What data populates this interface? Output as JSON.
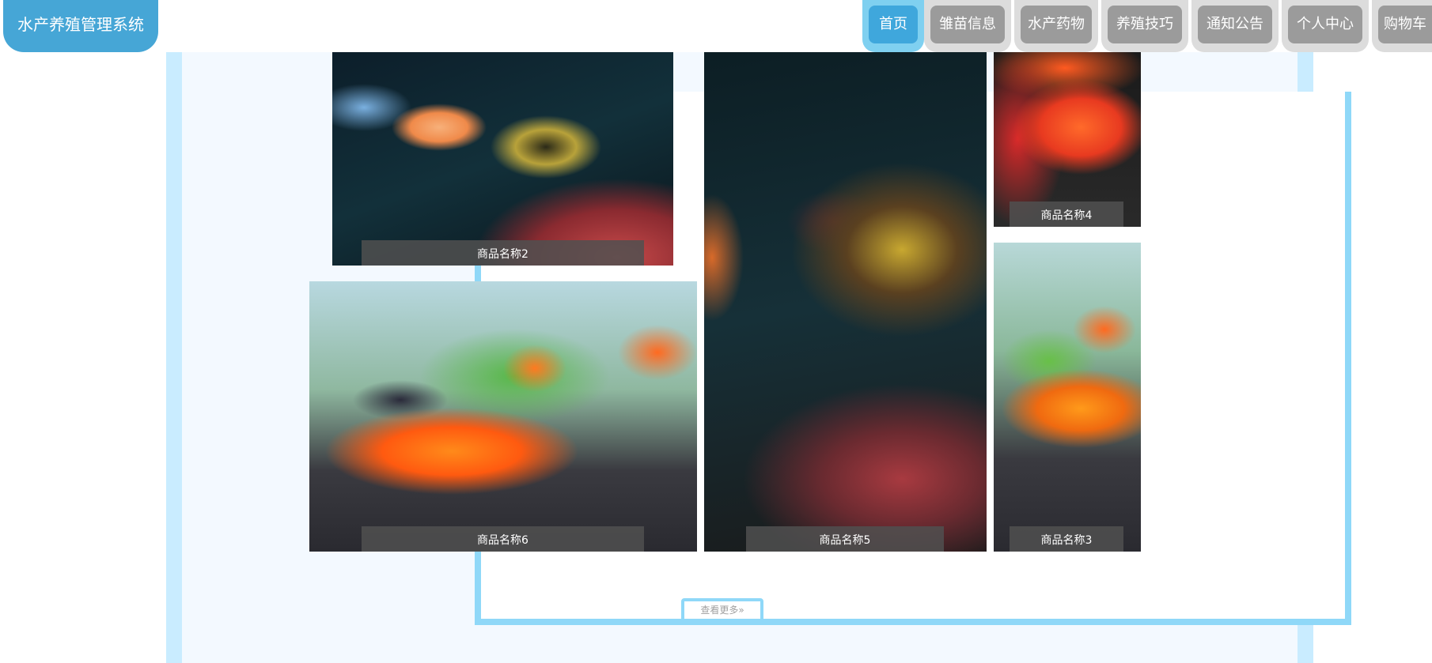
{
  "app": {
    "title": "水产养殖管理系统"
  },
  "nav": {
    "items": [
      {
        "label": "首页",
        "active": true
      },
      {
        "label": "雏苗信息"
      },
      {
        "label": "水产药物"
      },
      {
        "label": "养殖技巧"
      },
      {
        "label": "通知公告"
      },
      {
        "label": "个人中心"
      },
      {
        "label": "购物车"
      }
    ]
  },
  "gallery": {
    "products": [
      {
        "caption": "商品名称2"
      },
      {
        "caption": "商品名称6"
      },
      {
        "caption": "商品名称5"
      },
      {
        "caption": "商品名称4"
      },
      {
        "caption": "商品名称3"
      }
    ],
    "more_label": "查看更多"
  },
  "colors": {
    "accent": "#46a6d6",
    "nav_active_bg": "#3fa7dc",
    "nav_inactive_bg": "#9b9b9b",
    "frame_border": "#8fd8f8",
    "panel_bg": "#f3f9ff"
  }
}
